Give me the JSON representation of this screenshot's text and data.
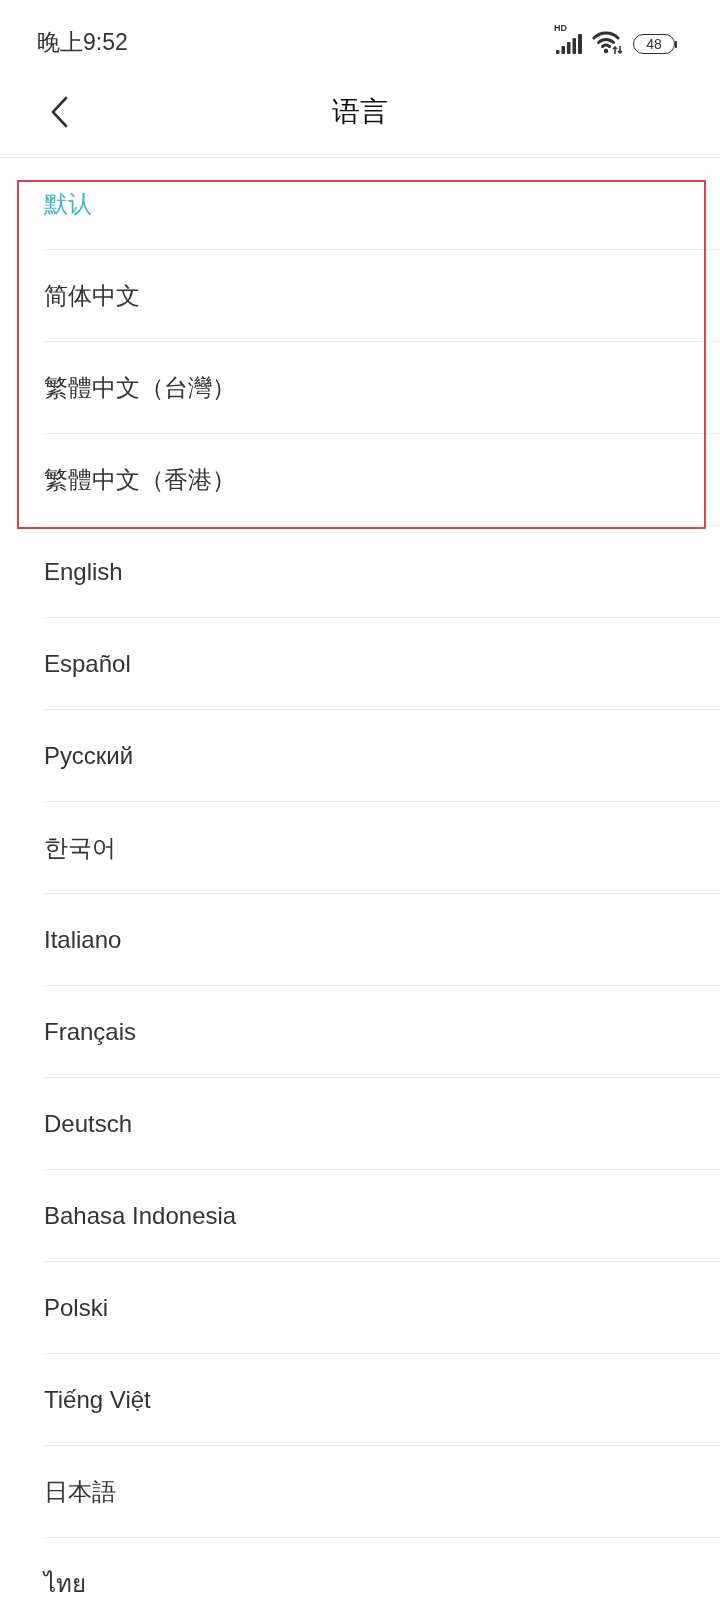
{
  "status_bar": {
    "time": "晚上9:52",
    "network": "HD",
    "battery": "48"
  },
  "header": {
    "title": "语言"
  },
  "languages": [
    {
      "label": "默认",
      "selected": true,
      "highlighted": true
    },
    {
      "label": "简体中文",
      "selected": false,
      "highlighted": true
    },
    {
      "label": "繁體中文（台灣）",
      "selected": false,
      "highlighted": true
    },
    {
      "label": "繁體中文（香港）",
      "selected": false,
      "highlighted": true
    },
    {
      "label": "English",
      "selected": false,
      "highlighted": false
    },
    {
      "label": "Español",
      "selected": false,
      "highlighted": false
    },
    {
      "label": "Русский",
      "selected": false,
      "highlighted": false
    },
    {
      "label": "한국어",
      "selected": false,
      "highlighted": false
    },
    {
      "label": "Italiano",
      "selected": false,
      "highlighted": false
    },
    {
      "label": "Français",
      "selected": false,
      "highlighted": false
    },
    {
      "label": "Deutsch",
      "selected": false,
      "highlighted": false
    },
    {
      "label": "Bahasa Indonesia",
      "selected": false,
      "highlighted": false
    },
    {
      "label": "Polski",
      "selected": false,
      "highlighted": false
    },
    {
      "label": "Tiếng Việt",
      "selected": false,
      "highlighted": false
    },
    {
      "label": "日本語",
      "selected": false,
      "highlighted": false
    },
    {
      "label": "ไทย",
      "selected": false,
      "highlighted": false
    }
  ]
}
